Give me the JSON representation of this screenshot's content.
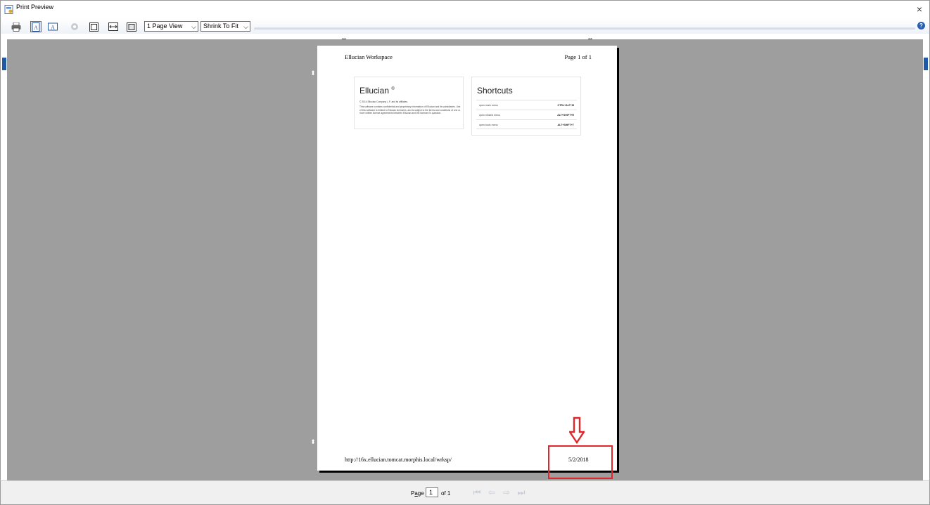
{
  "window": {
    "title": "Print Preview",
    "close_label": "×"
  },
  "toolbar": {
    "page_view_value": "1 Page View",
    "shrink_value": "Shrink To Fit",
    "help_label": "?"
  },
  "page": {
    "header_left": "Ellucian Workspace",
    "header_right": "Page 1 of 1",
    "footer_left": "http://16x.ellucian.tomcat.morphis.local/wrksp/",
    "footer_right": "5/2/2018"
  },
  "ellucian_card": {
    "title": "Ellucian",
    "registered": "®",
    "copyright": "© 2014 Ellucian Company L.P. and its affiliates.",
    "body": "This software contains confidential and proprietary information of Ellucian and its subsidiaries. Use of this software is limited to Ellucian licensees, and is subject to the terms and conditions of one or more written license agreements between Ellucian and the licensee in question."
  },
  "shortcuts_card": {
    "title": "Shortcuts",
    "rows": [
      {
        "label": "open main menu",
        "keys": "CTRL+ALT+M"
      },
      {
        "label": "open related menu",
        "keys": "ALT+SHIFT+R"
      },
      {
        "label": "open tools menu",
        "keys": "ALT+SHIFT+T"
      }
    ]
  },
  "statusbar": {
    "page_label_pre": "P",
    "page_label_u": "a",
    "page_label_post": "ge",
    "page_value": "1",
    "of_label": "of 1"
  },
  "colors": {
    "preview_bg": "#9e9e9e",
    "annotation_red": "#e0262b",
    "accent_blue": "#1e5aa8"
  }
}
